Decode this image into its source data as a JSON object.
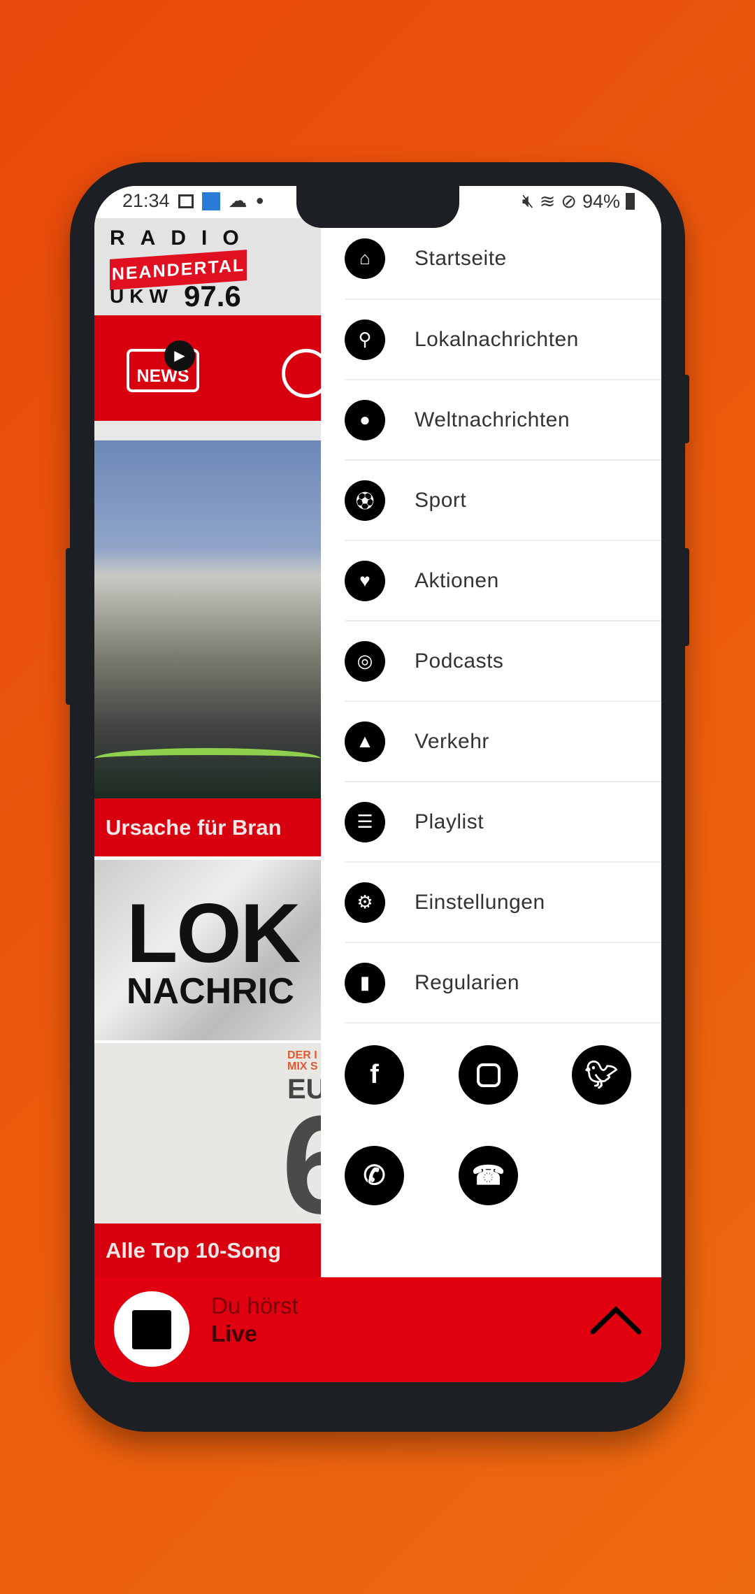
{
  "status_bar": {
    "time": "21:34",
    "battery": "94%",
    "icons": [
      "image-icon",
      "app-icon",
      "cloud-icon",
      "dot-icon",
      "mute-icon",
      "wifi-icon",
      "block-icon",
      "battery-icon"
    ]
  },
  "logo": {
    "line1": "RADIO",
    "line2": "NEANDERTAL",
    "line3": "UKW",
    "frequency": "97.6"
  },
  "quick_links": {
    "news_label": "NEWS"
  },
  "feed": [
    {
      "caption": "Ursache für Bran"
    },
    {
      "image_text_1": "LOK",
      "image_text_2": "NACHRIC"
    },
    {
      "image_text_1": "DER I",
      "image_text_2": "MIX S",
      "image_text_3": "EU",
      "image_text_4": "6",
      "caption": "Alle Top 10-Song"
    }
  ],
  "menu": {
    "items": [
      {
        "label": "Startseite",
        "icon": "home-icon"
      },
      {
        "label": "Lokalnachrichten",
        "icon": "map-pin-icon"
      },
      {
        "label": "Weltnachrichten",
        "icon": "globe-icon"
      },
      {
        "label": "Sport",
        "icon": "football-icon"
      },
      {
        "label": "Aktionen",
        "icon": "heart-icon"
      },
      {
        "label": "Podcasts",
        "icon": "podcast-icon"
      },
      {
        "label": "Verkehr",
        "icon": "road-icon"
      },
      {
        "label": "Playlist",
        "icon": "list-icon"
      },
      {
        "label": "Einstellungen",
        "icon": "gear-icon"
      },
      {
        "label": "Regularien",
        "icon": "document-icon"
      }
    ],
    "social": [
      "facebook-icon",
      "instagram-icon",
      "twitter-icon",
      "whatsapp-icon",
      "phone-icon"
    ]
  },
  "player": {
    "now_label": "Du hörst",
    "station": "Live"
  },
  "colors": {
    "brand_red": "#e0000f",
    "background_orange": "#ec5a0c"
  }
}
